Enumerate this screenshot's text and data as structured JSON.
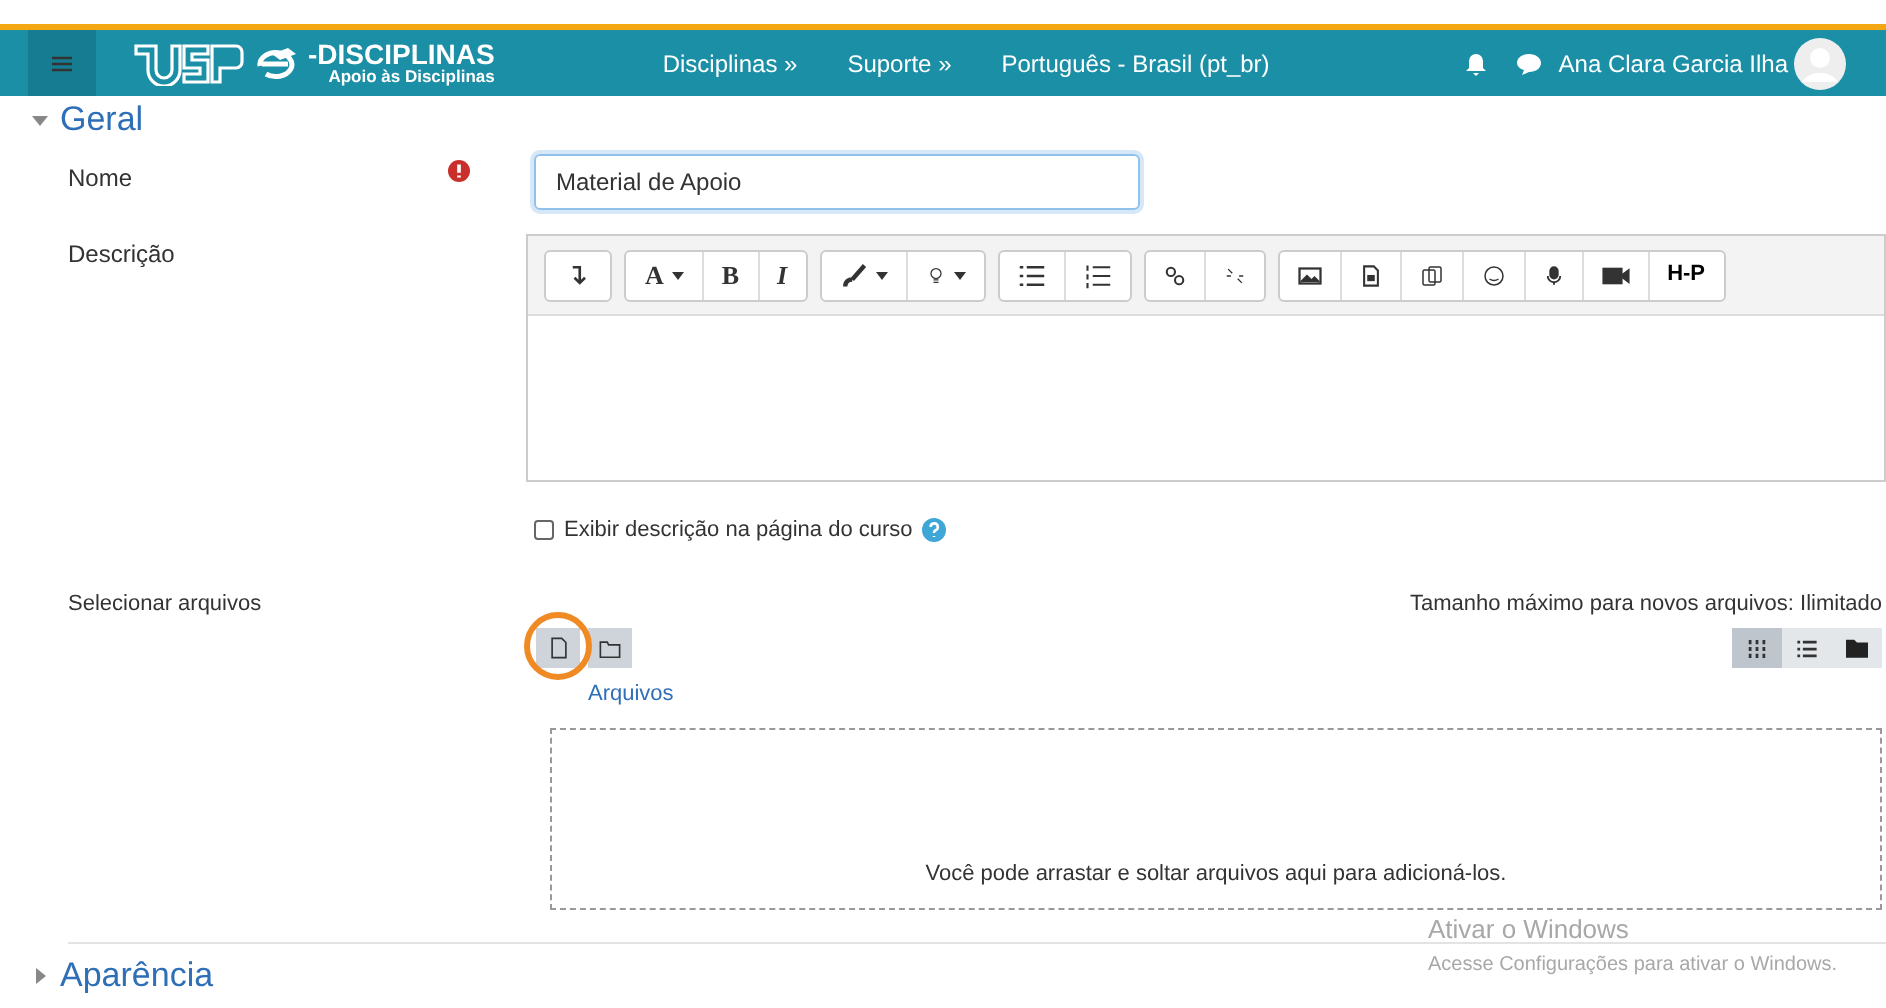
{
  "navbar": {
    "logo_main": "-DISCIPLINAS",
    "logo_sub": "Apoio às Disciplinas",
    "links": [
      "Disciplinas »",
      "Suporte »",
      "Português - Brasil (pt_br)"
    ],
    "user_name": "Ana Clara Garcia Ilha"
  },
  "sections": [
    {
      "title": "Geral",
      "expanded": true
    },
    {
      "title": "Aparência",
      "expanded": false
    }
  ],
  "name_field": {
    "label": "Nome",
    "value": "Material de Apoio",
    "required": true
  },
  "description": {
    "label": "Descrição",
    "toolbar_text": [
      "A",
      "B",
      "I",
      "H-P"
    ],
    "show_on_course": {
      "label": "Exibir descrição na página do curso",
      "checked": false
    }
  },
  "files": {
    "label": "Selecionar arquivos",
    "max_size": "Tamanho máximo para novos arquivos: Ilimitado",
    "breadcrumb": "Arquivos",
    "view_modes": [
      {
        "selected": true
      },
      {
        "selected": false
      },
      {
        "selected": false
      }
    ],
    "dropzone_text": "Você pode arrastar e soltar arquivos aqui para adicioná-los."
  },
  "os_notice": {
    "title": "Ativar o Windows",
    "text": "Acesse Configurações para ativar o Windows."
  }
}
